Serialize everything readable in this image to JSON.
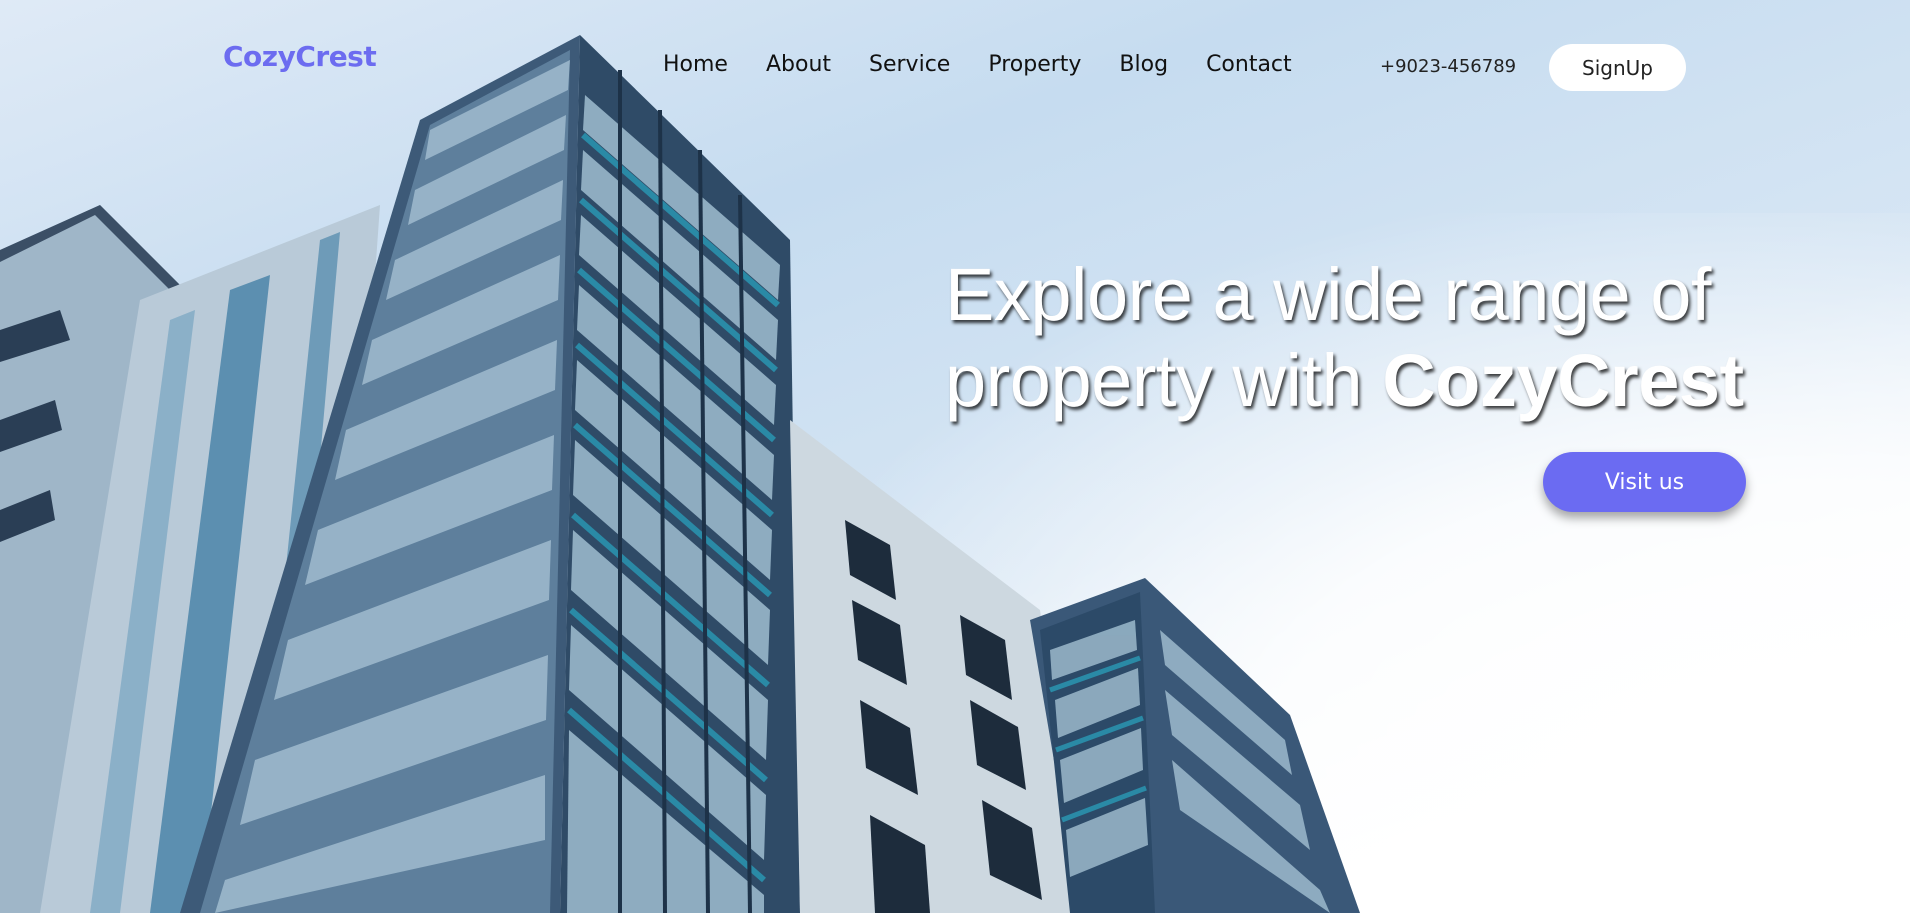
{
  "brand": {
    "logo_text": "CozyCrest"
  },
  "nav": {
    "items": [
      {
        "label": "Home"
      },
      {
        "label": "About"
      },
      {
        "label": "Service"
      },
      {
        "label": "Property"
      },
      {
        "label": "Blog"
      },
      {
        "label": "Contact"
      }
    ],
    "phone": "+9023-456789",
    "signup_label": "SignUp"
  },
  "hero": {
    "headline_line1": "Explore a wide range of",
    "headline_line2_prefix": "property with ",
    "headline_brand": "CozyCrest",
    "cta_label": "Visit us",
    "image_subject": "modern-apartment-building"
  },
  "colors": {
    "brand": "#6c6cf0",
    "cta_background": "#6b6bf2",
    "signup_background": "#ffffff"
  }
}
